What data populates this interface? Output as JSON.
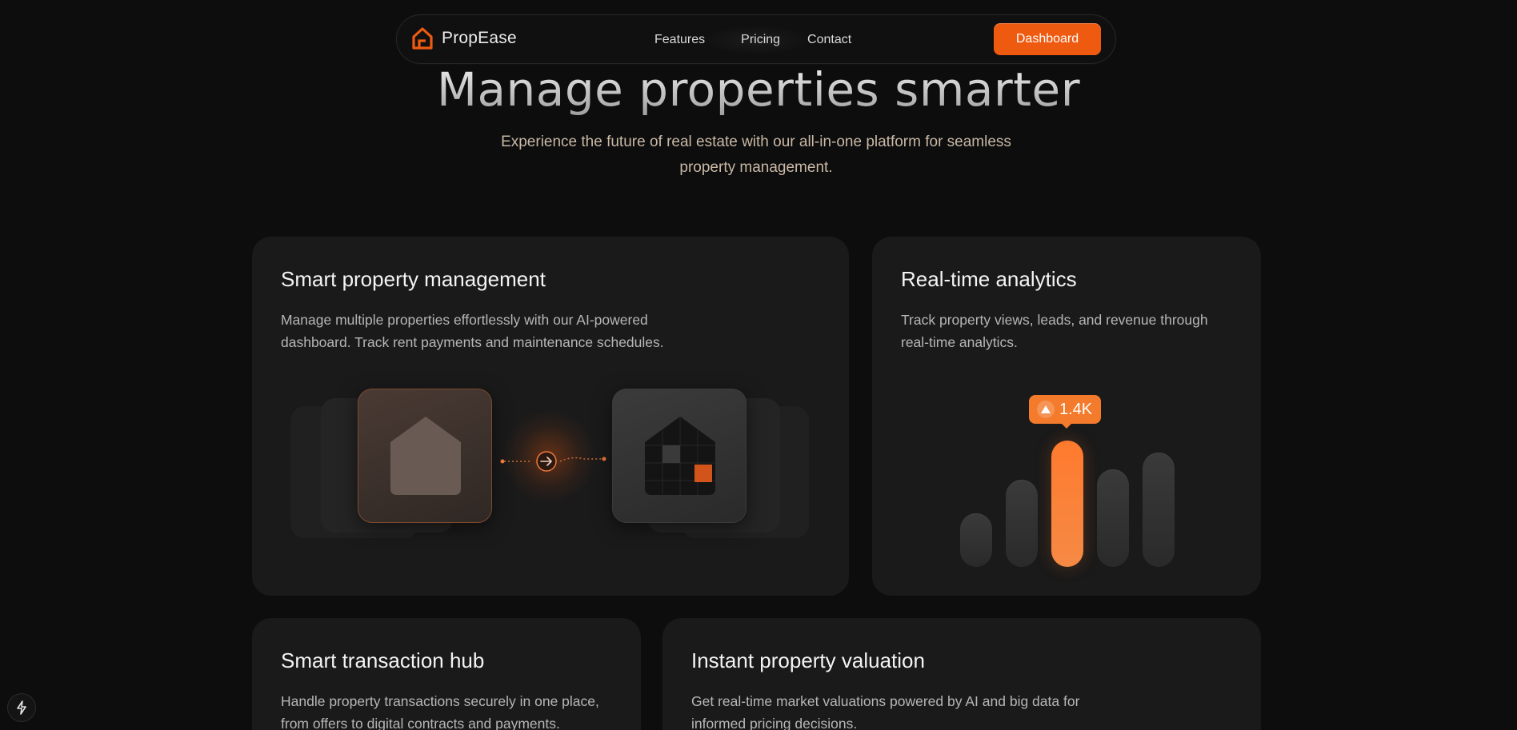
{
  "brand": {
    "name": "PropEase",
    "accent": "#ee5a10"
  },
  "nav": {
    "links": [
      "Features",
      "Pricing",
      "Contact"
    ],
    "cta": "Dashboard"
  },
  "hero": {
    "title": "Manage properties smarter",
    "subtitle_line1": "Experience the future of real estate with our all-in-one platform for seamless",
    "subtitle_line2": "property management."
  },
  "cards": [
    {
      "title": "Smart property management",
      "desc_line1": "Manage multiple properties effortlessly with our AI-powered",
      "desc_line2": "dashboard. Track rent payments and maintenance schedules."
    },
    {
      "title": "Real-time analytics",
      "desc_line1": "Track property views, leads, and revenue through",
      "desc_line2": "real-time analytics.",
      "badge": "1.4K",
      "bars": [
        {
          "level": 0.32,
          "active": false
        },
        {
          "level": 0.52,
          "active": false
        },
        {
          "level": 0.75,
          "active": true
        },
        {
          "level": 0.58,
          "active": false
        },
        {
          "level": 0.68,
          "active": false
        }
      ]
    },
    {
      "title": "Smart transaction hub",
      "desc_line1": "Handle property transactions securely in one place,",
      "desc_line2": "from offers to digital contracts and payments."
    },
    {
      "title": "Instant property valuation",
      "desc_line1": "Get real-time market valuations powered by AI and big data for",
      "desc_line2": "informed pricing decisions."
    }
  ],
  "icons": {
    "logo": "house-outline-icon",
    "arrow": "arrow-right-circle-icon",
    "badge": "triangle-up-icon",
    "fab": "lightning-icon"
  }
}
